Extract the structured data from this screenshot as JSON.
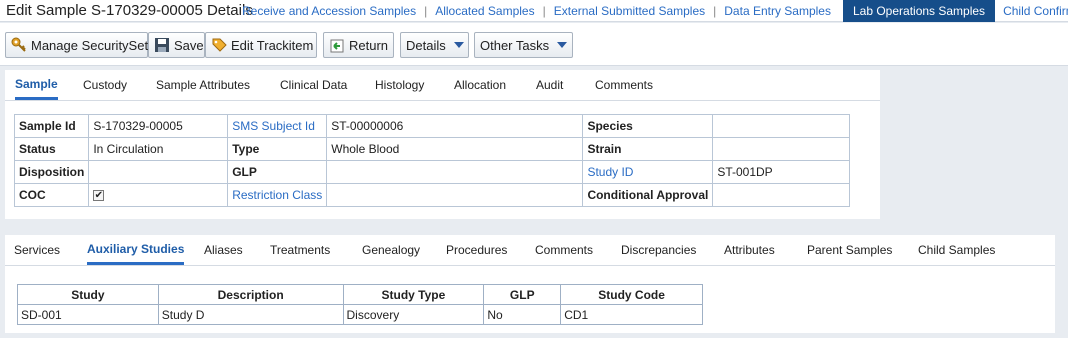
{
  "header": {
    "title": "Edit Sample S-170329-00005 Details",
    "nav": [
      {
        "label": "Receive and Accession Samples"
      },
      {
        "label": "Allocated Samples"
      },
      {
        "label": "External Submitted Samples"
      },
      {
        "label": "Data Entry Samples"
      },
      {
        "label": "Lab Operations Samples",
        "active": true
      },
      {
        "label": "Child Confirmati"
      }
    ]
  },
  "toolbar": {
    "manage_security": "Manage SecuritySet",
    "save": "Save",
    "edit_trackitem": "Edit Trackitem",
    "return": "Return",
    "details": "Details",
    "other_tasks": "Other Tasks"
  },
  "sample_tabs": [
    "Sample",
    "Custody",
    "Sample Attributes",
    "Clinical Data",
    "Histology",
    "Allocation",
    "Audit",
    "Comments"
  ],
  "sample_active_tab": "Sample",
  "sample_info": {
    "sample_id_label": "Sample Id",
    "sample_id": "S-170329-00005",
    "sms_subject_id_label": "SMS Subject Id",
    "sms_subject_id": "ST-00000006",
    "species_label": "Species",
    "species": "",
    "status_label": "Status",
    "status": "In Circulation",
    "type_label": "Type",
    "type": "Whole Blood",
    "strain_label": "Strain",
    "strain": "",
    "disposition_label": "Disposition",
    "disposition": "",
    "glp_label": "GLP",
    "glp": "",
    "study_id_label": "Study ID",
    "study_id": "ST-001DP",
    "coc_label": "COC",
    "coc_checked": true,
    "restriction_class_label": "Restriction Class",
    "restriction_class": "",
    "conditional_approval_label": "Conditional Approval",
    "conditional_approval": ""
  },
  "lower_tabs": [
    "Services",
    "Auxiliary Studies",
    "Aliases",
    "Treatments",
    "Genealogy",
    "Procedures",
    "Comments",
    "Discrepancies",
    "Attributes",
    "Parent Samples",
    "Child Samples"
  ],
  "lower_active_tab": "Auxiliary Studies",
  "aux_table": {
    "columns": [
      "Study",
      "Description",
      "Study Type",
      "GLP",
      "Study Code"
    ],
    "rows": [
      [
        "SD-001",
        "Study D",
        "Discovery",
        "No",
        "CD1"
      ]
    ]
  }
}
